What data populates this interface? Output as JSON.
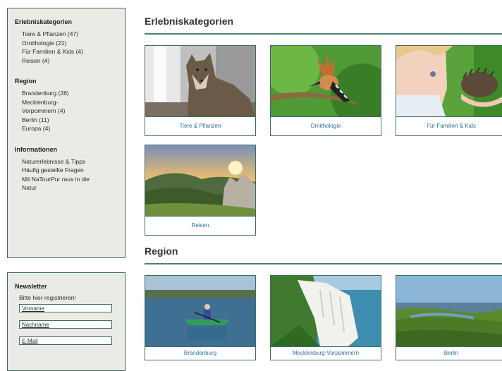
{
  "sidebar": {
    "categories": {
      "title": "Erlebniskategorien",
      "items": [
        "Tiere & Pflanzen (47)",
        "Ornithologie (21)",
        "Für Familien & Kids (4)",
        "Reisen (4)"
      ]
    },
    "region": {
      "title": "Region",
      "items": [
        "Brandenburg (28)",
        "Mecklenburg-",
        "Vorpommern (4)",
        "Berlin (11)",
        "Europa (4)"
      ]
    },
    "info": {
      "title": "Informationen",
      "items": [
        "Naturerlebnisse & Tipps",
        "Häufig gestellte Fragen",
        "Mit NaTourPur raus in die",
        "Natur"
      ]
    },
    "newsletter": {
      "title": "Newsletter",
      "intro": "Bitte hier registrieren!",
      "first_name_placeholder": "Vorname",
      "last_name_placeholder": "Nachname",
      "email_placeholder": "E-Mail"
    }
  },
  "main": {
    "categories_heading": "Erlebniskategorien",
    "category_cards": [
      {
        "label": "Tiere & Pflanzen"
      },
      {
        "label": "Ornithologie"
      },
      {
        "label": "Für Familien & Kids"
      },
      {
        "label": "Reisen"
      }
    ],
    "region_heading": "Region",
    "region_cards": [
      {
        "label": "Brandenburg"
      },
      {
        "label": "Mecklenburg-Vorpommern"
      },
      {
        "label": "Berlin"
      }
    ]
  },
  "colors": {
    "accent_border": "#3f6e63",
    "sidebar_bg": "#ebebe6",
    "link_blue": "#2f6fa0"
  }
}
